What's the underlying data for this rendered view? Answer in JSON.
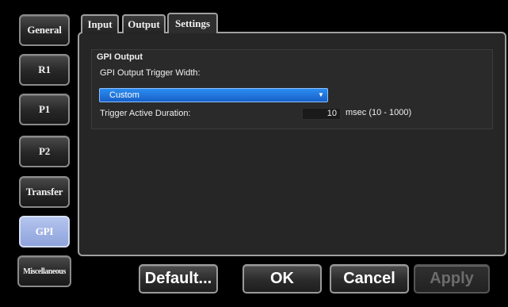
{
  "sidebar": {
    "items": [
      {
        "label": "General"
      },
      {
        "label": "R1"
      },
      {
        "label": "P1"
      },
      {
        "label": "P2"
      },
      {
        "label": "Transfer"
      },
      {
        "label": "GPI",
        "active": true
      },
      {
        "label": "Miscellaneous"
      }
    ]
  },
  "tabs": [
    {
      "label": "Input"
    },
    {
      "label": "Output"
    },
    {
      "label": "Settings",
      "active": true
    }
  ],
  "settings": {
    "group_title": "GPI Output",
    "trigger_width_label": "GPI Output Trigger Width:",
    "trigger_width_value": "Custom",
    "duration_label": "Trigger Active Duration:",
    "duration_value": "10",
    "duration_unit": "msec (10 - 1000)"
  },
  "footer": {
    "default_label": "Default...",
    "ok_label": "OK",
    "cancel_label": "Cancel",
    "apply_label": "Apply"
  },
  "colors": {
    "active_nav": "#9fb2e6",
    "select_blue": "#1f74dc"
  },
  "icons": {
    "select_arrow": "dropdown-arrow-icon"
  }
}
